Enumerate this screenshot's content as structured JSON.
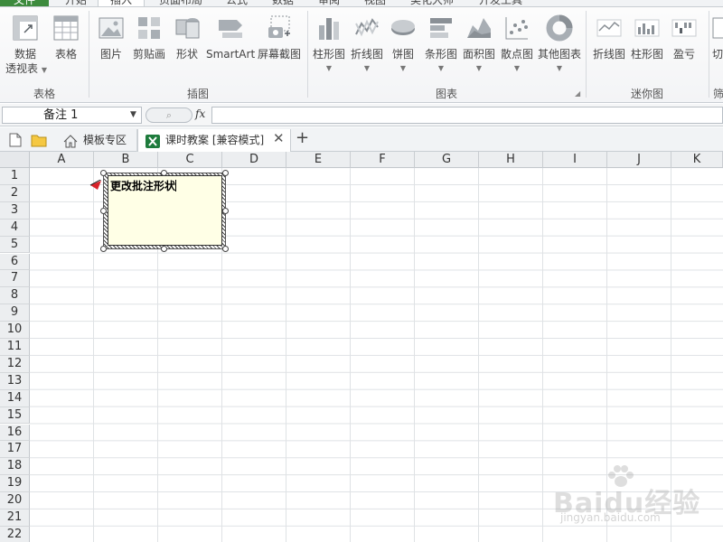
{
  "menu": {
    "tabs": [
      "文件",
      "开始",
      "插入",
      "页面布局",
      "公式",
      "数据",
      "审阅",
      "视图",
      "美化大师",
      "开发工具"
    ],
    "active": "插入"
  },
  "ribbon": {
    "pivot_line1": "数据",
    "pivot_line2": "透视表",
    "table": "表格",
    "picture": "图片",
    "clipart": "剪贴画",
    "shapes": "形状",
    "smartart": "SmartArt",
    "screenshot": "屏幕截图",
    "column_chart": "柱形图",
    "line_chart": "折线图",
    "pie_chart": "饼图",
    "bar_chart": "条形图",
    "area_chart": "面积图",
    "scatter_chart": "散点图",
    "other_charts": "其他图表",
    "spark_line": "折线图",
    "spark_column": "柱形图",
    "spark_winloss": "盈亏",
    "slicer_partial": "切",
    "group_table": "表格",
    "group_illustrations": "插图",
    "group_charts": "图表",
    "group_sparklines": "迷你图",
    "group_filter_partial": "筛"
  },
  "formula_bar": {
    "name_box": "备注 1",
    "fx": "fx",
    "value": ""
  },
  "doc_tabs": {
    "template": "模板专区",
    "lesson": "课时教案 [兼容模式]",
    "add": "+",
    "close": "✕"
  },
  "sheet": {
    "columns": [
      "A",
      "B",
      "C",
      "D",
      "E",
      "F",
      "G",
      "H",
      "I",
      "J",
      "K"
    ],
    "rows": [
      "1",
      "2",
      "3",
      "4",
      "5",
      "6",
      "7",
      "8",
      "9",
      "10",
      "11",
      "12",
      "13",
      "14",
      "15",
      "16",
      "17",
      "18",
      "19",
      "20",
      "21",
      "22"
    ]
  },
  "comment": {
    "text": "更改批注形状"
  },
  "watermark": {
    "logo": "Baidu经验",
    "url": "jingyan.baidu.com"
  },
  "colors": {
    "file_tab": "#3d8b3d",
    "chart_icon": "#8a9096",
    "comment_bg": "#ffffe6",
    "marker": "#d8232a"
  }
}
